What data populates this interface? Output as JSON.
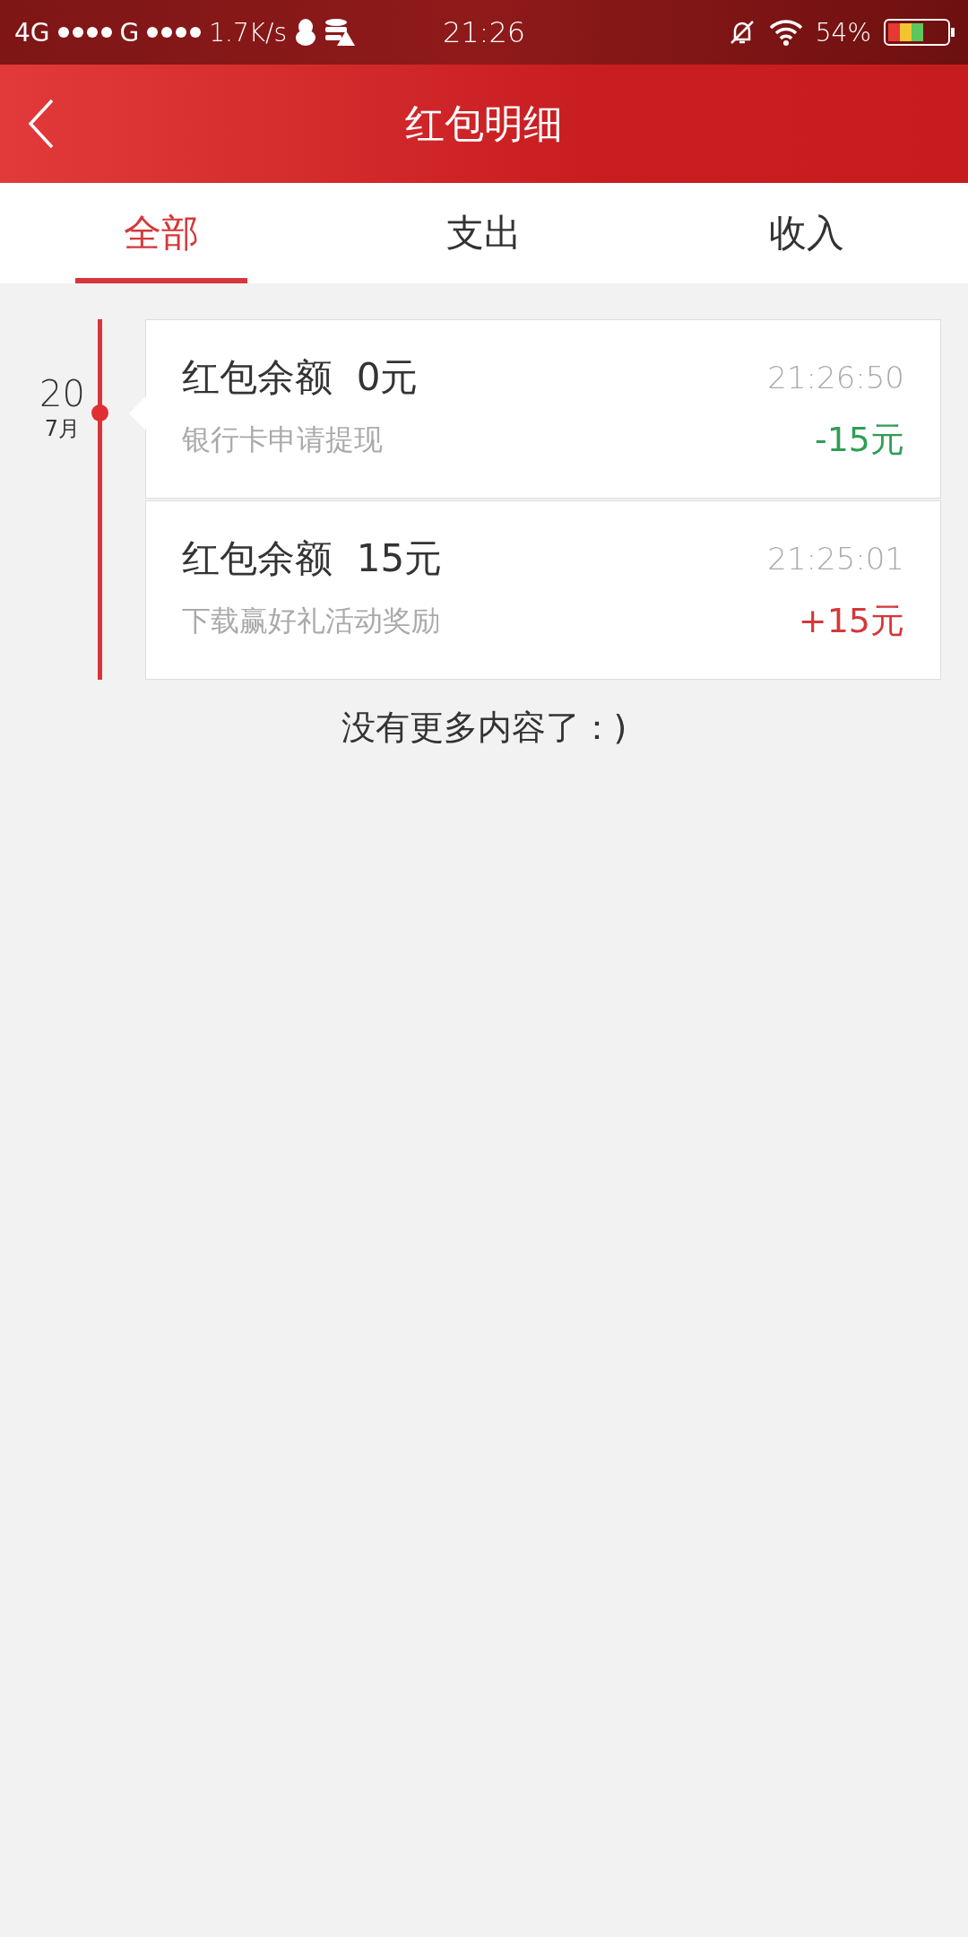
{
  "status_bar": {
    "network_1": "4G",
    "network_2": "G",
    "speed": "1.7K/s",
    "time": "21:26",
    "battery": "54%"
  },
  "header": {
    "title": "红包明细"
  },
  "tabs": [
    {
      "label": "全部",
      "selected": true
    },
    {
      "label": "支出",
      "selected": false
    },
    {
      "label": "收入",
      "selected": false
    }
  ],
  "groups": [
    {
      "day": "20",
      "month": "7月",
      "entries": [
        {
          "title": "红包余额  0元",
          "time": "21:26:50",
          "description": "银行卡申请提现",
          "amount": "-15元",
          "kind": "expense"
        },
        {
          "title": "红包余额  15元",
          "time": "21:25:01",
          "description": "下载赢好礼活动奖励",
          "amount": "+15元",
          "kind": "income"
        }
      ]
    }
  ],
  "footer": "没有更多内容了：)"
}
